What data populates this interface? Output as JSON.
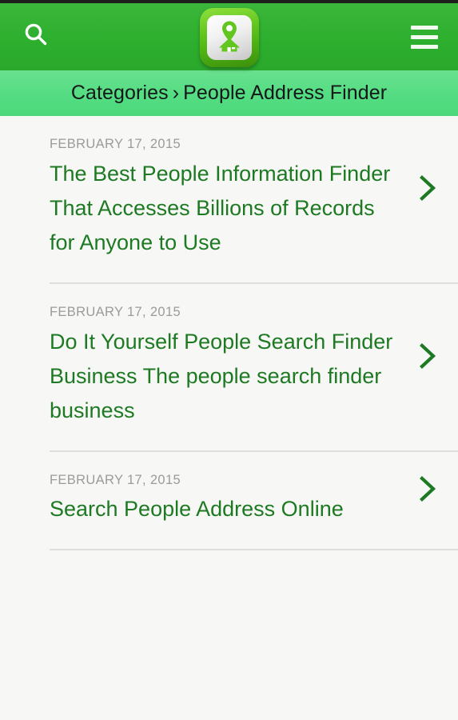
{
  "header": {
    "search_label": "Search",
    "menu_label": "Menu",
    "logo_label": "People Address Finder logo",
    "bg_color": "#2eaf2e"
  },
  "breadcrumb": {
    "root": "Categories",
    "separator": "›",
    "current": "People Address Finder",
    "bg_color": "#56dd83"
  },
  "list": {
    "items": [
      {
        "date": "FEBRUARY 17, 2015",
        "title": "The Best People Information Finder That Accesses Billions of Records for Anyone to Use"
      },
      {
        "date": "FEBRUARY 17, 2015",
        "title": "Do It Yourself People Search Finder Business The people search finder business"
      },
      {
        "date": "FEBRUARY 17, 2015",
        "title": "Search People Address Online"
      }
    ],
    "title_color": "#1d7a22",
    "date_color": "#9b9b9b",
    "background": "#f7f7f5"
  }
}
